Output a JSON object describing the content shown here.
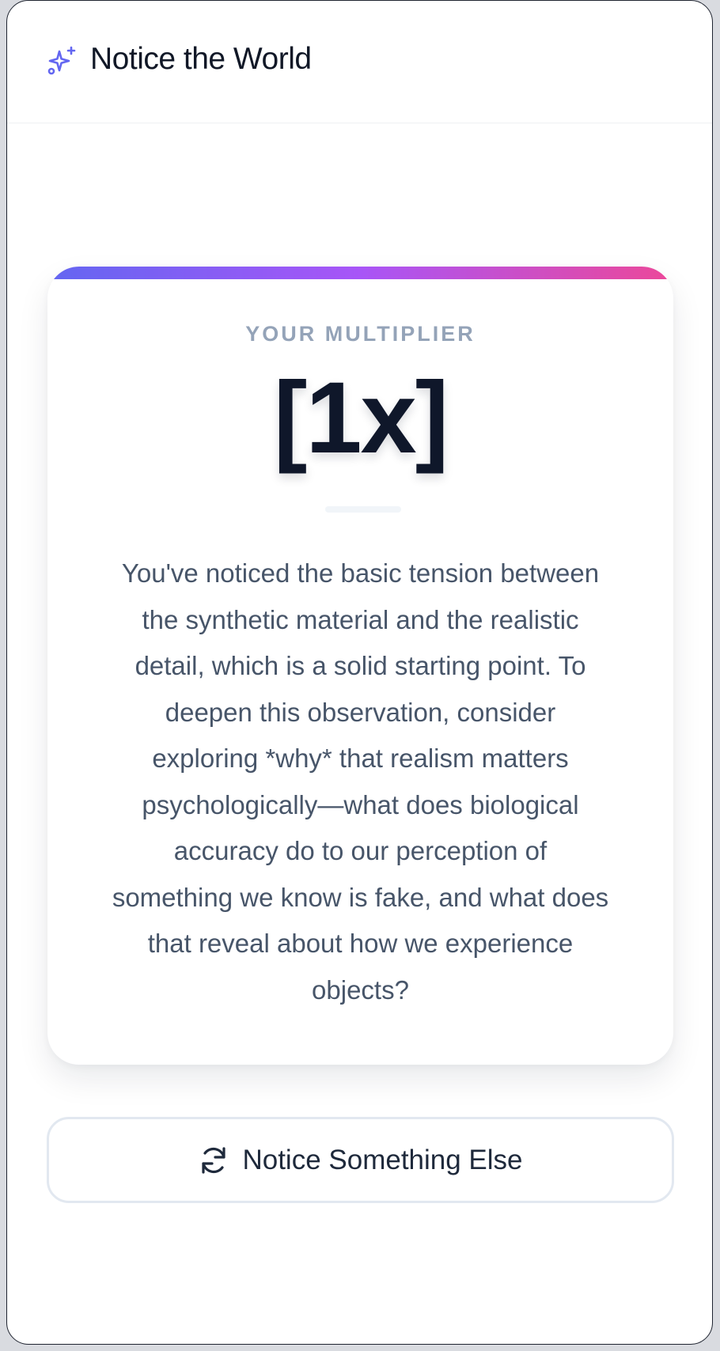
{
  "app": {
    "title": "Notice the World",
    "icon": "sparkles-icon",
    "accent_color": "#6366f1"
  },
  "result_card": {
    "label": "YOUR MULTIPLIER",
    "value": "[1x]",
    "accent_gradient": [
      "#6366f1",
      "#a855f7",
      "#ec4899"
    ],
    "feedback": "You've noticed the basic tension between the synthetic material and the realistic detail, which is a solid starting point. To deepen this observation, consider exploring *why* that realism matters psychologically—what does biological accuracy do to our perception of something we know is fake, and what does that reveal about how we experience objects?"
  },
  "actions": {
    "notice_again_label": "Notice Something Else",
    "notice_again_icon": "refresh-icon"
  }
}
